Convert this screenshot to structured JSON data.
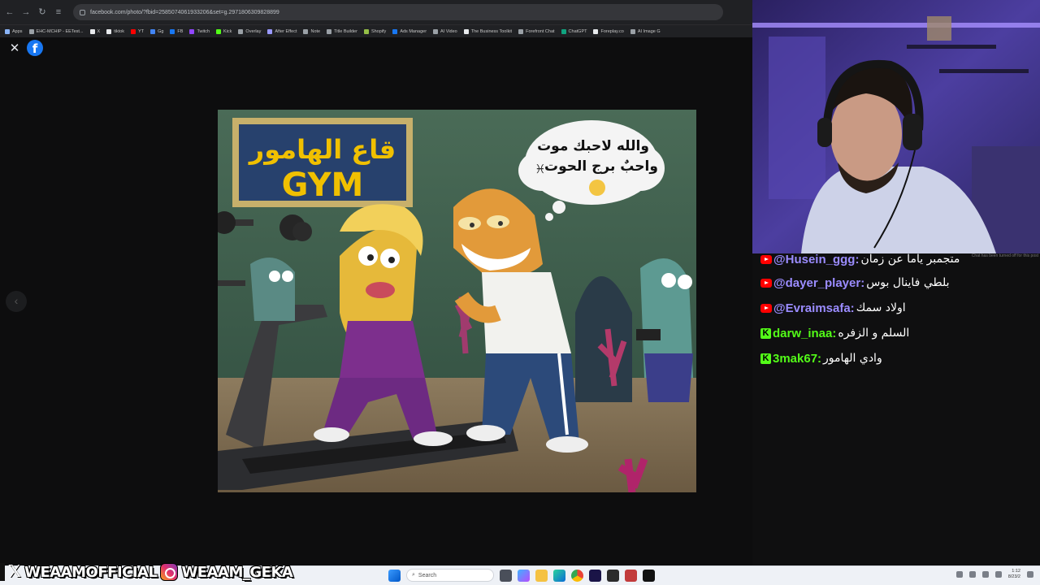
{
  "browser": {
    "url": "facebook.com/photo/?fbid=2585074061933206&set=g.2971806309828899",
    "bookmarks": [
      {
        "label": "Apps",
        "color": "#8ab4f8"
      },
      {
        "label": "EHC-MCHIP - EETest...",
        "color": "#9aa0a6"
      },
      {
        "label": "X",
        "color": "#e8eaed"
      },
      {
        "label": "tiktok",
        "color": "#e8eaed"
      },
      {
        "label": "YT",
        "color": "#ff0000"
      },
      {
        "label": "Gg",
        "color": "#4285f4"
      },
      {
        "label": "FB",
        "color": "#1877f2"
      },
      {
        "label": "Twitch",
        "color": "#9146ff"
      },
      {
        "label": "Kick",
        "color": "#53fc18"
      },
      {
        "label": "Overlay",
        "color": "#9aa0a6"
      },
      {
        "label": "After Effect",
        "color": "#9999ff"
      },
      {
        "label": "Note",
        "color": "#9aa0a6"
      },
      {
        "label": "Title Builder",
        "color": "#9aa0a6"
      },
      {
        "label": "Shopify",
        "color": "#95bf47"
      },
      {
        "label": "Ads Manager",
        "color": "#1877f2"
      },
      {
        "label": "AI Video",
        "color": "#9aa0a6"
      },
      {
        "label": "The Business Toolkit",
        "color": "#e8eaed"
      },
      {
        "label": "Forefront Chat",
        "color": "#9aa0a6"
      },
      {
        "label": "ChatGPT",
        "color": "#10a37f"
      },
      {
        "label": "Foreplay.co",
        "color": "#e8eaed"
      },
      {
        "label": "AI Image G",
        "color": "#9aa0a6"
      }
    ]
  },
  "photo": {
    "sign_arabic": "قاع الهامور",
    "sign_english": "GYM",
    "bubble_line1": "والله لاحبك موت",
    "bubble_line2": "واحبٌ برج الحوت",
    "zodiac_symbol": "♓",
    "emoji": "😌"
  },
  "chat": {
    "notice": "Chat has been turned off for this post",
    "messages": [
      {
        "platform": "youtube",
        "user": "@Husein_ggg:",
        "text": "متجمبر ياما عن زمان"
      },
      {
        "platform": "youtube",
        "user": "@dayer_player:",
        "text": "بلطي فاينال بوس"
      },
      {
        "platform": "youtube",
        "user": "@Evraimsafa:",
        "text": "اولاد سمك"
      },
      {
        "platform": "kick",
        "user": "darw_inaa:",
        "text": "السلم و الزفره"
      },
      {
        "platform": "kick",
        "user": "3mak67:",
        "text": "وادي الهامور"
      }
    ]
  },
  "taskbar": {
    "search_placeholder": "Search",
    "clock_time": "1:12",
    "clock_date": "8/23/2"
  },
  "social": {
    "handle_x": "WEAAMOFFICIAL",
    "handle_ig": "WEAAM_GEKA"
  }
}
